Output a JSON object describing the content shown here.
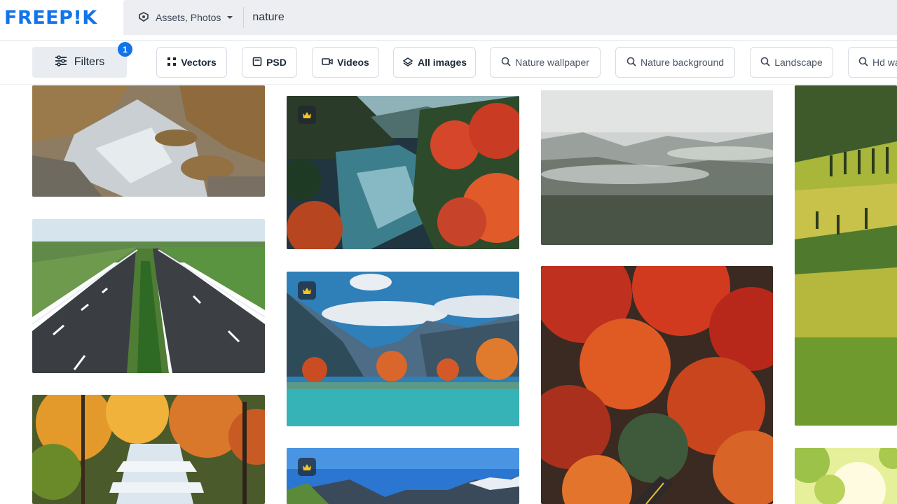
{
  "brand": {
    "logo_text": "FREEP!K",
    "accent": "#1273eb"
  },
  "search": {
    "asset_type_label": "Assets, Photos",
    "query": "nature"
  },
  "filters": {
    "button_label": "Filters",
    "active_count": "1"
  },
  "chips": [
    {
      "label": "Vectors",
      "icon": "vectors-icon"
    },
    {
      "label": "PSD",
      "icon": "psd-icon"
    },
    {
      "label": "Videos",
      "icon": "video-icon"
    },
    {
      "label": "All images",
      "icon": "all-images-icon"
    },
    {
      "label": "Nature wallpaper",
      "icon": "search-icon"
    },
    {
      "label": "Nature background",
      "icon": "search-icon"
    },
    {
      "label": "Landscape",
      "icon": "search-icon"
    },
    {
      "label": "Hd wa",
      "icon": "search-icon"
    }
  ],
  "results": [
    {
      "name": "river-rocks-photo",
      "premium": false
    },
    {
      "name": "highway-photo",
      "premium": false
    },
    {
      "name": "waterfall-autumn-photo",
      "premium": false
    },
    {
      "name": "autumn-lake-photo",
      "premium": true
    },
    {
      "name": "mountain-lake-photo",
      "premium": true
    },
    {
      "name": "blue-sky-mountains-photo",
      "premium": true
    },
    {
      "name": "misty-forest-photo",
      "premium": false
    },
    {
      "name": "red-autumn-forest-photo",
      "premium": false
    },
    {
      "name": "green-hills-photo",
      "premium": false
    },
    {
      "name": "sunlit-leaves-photo",
      "premium": false
    }
  ]
}
